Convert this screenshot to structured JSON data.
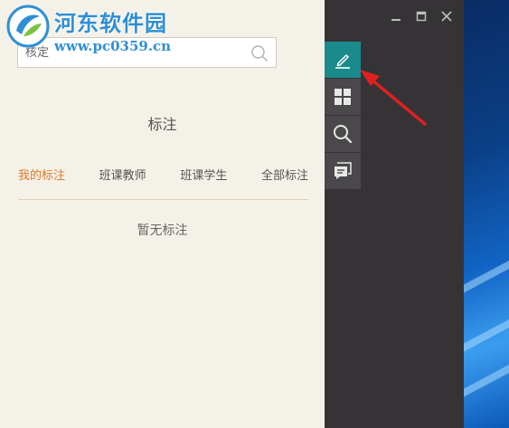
{
  "watermark": {
    "site_name": "河东软件园",
    "url": "www.pc0359.cn"
  },
  "search": {
    "placeholder": "核定"
  },
  "panel": {
    "title": "标注",
    "tabs": [
      {
        "label": "我的标注",
        "active": true
      },
      {
        "label": "班课教师",
        "active": false
      },
      {
        "label": "班课学生",
        "active": false
      },
      {
        "label": "全部标注",
        "active": false
      }
    ],
    "empty_message": "暂无标注"
  },
  "toolbar": {
    "items": [
      {
        "name": "pen-icon",
        "active": true
      },
      {
        "name": "grid-icon",
        "active": false
      },
      {
        "name": "search-icon",
        "active": false
      },
      {
        "name": "comment-icon",
        "active": false
      }
    ]
  },
  "window_controls": [
    "minimize-icon",
    "maximize-icon",
    "close-icon"
  ],
  "colors": {
    "panel_bg": "#f4f1e8",
    "window_bg": "#353336",
    "active_tool": "#1b8a8c",
    "active_tab": "#e07a28",
    "watermark": "#2f8fd4",
    "annotation_arrow": "#e02020"
  }
}
